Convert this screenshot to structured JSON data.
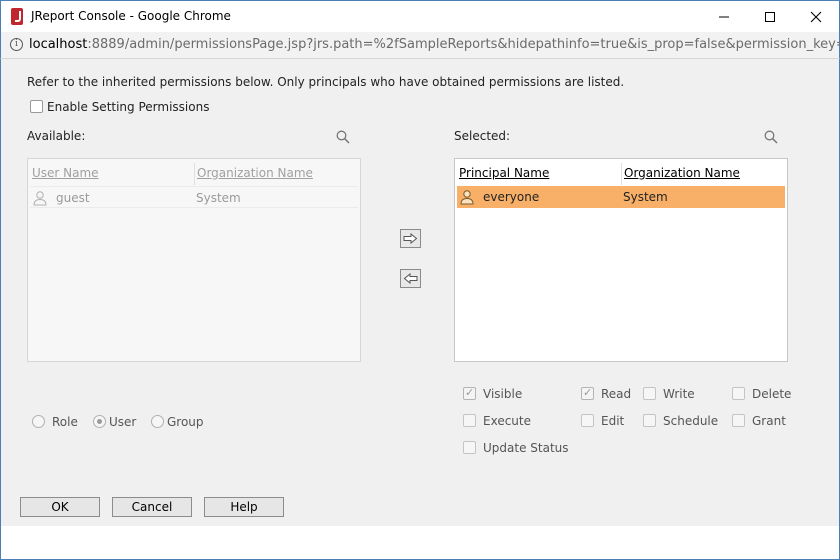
{
  "window": {
    "title": "JReport Console - Google Chrome",
    "url_host": "localhost",
    "url_rest": ":8889/admin/permissionsPage.jsp?jrs.path=%2fSampleReports&hidepathinfo=true&is_prop=false&permission_key="
  },
  "intro_text": "Refer to the inherited permissions below. Only principals who have obtained permissions are listed.",
  "enable_setting": {
    "label": "Enable Setting Permissions",
    "checked": false
  },
  "available": {
    "label": "Available:",
    "columns": [
      "User Name",
      "Organization Name"
    ],
    "rows": [
      {
        "name": "guest",
        "org": "System"
      }
    ]
  },
  "selected": {
    "label": "Selected:",
    "columns": [
      "Principal Name",
      "Organization Name"
    ],
    "rows": [
      {
        "name": "everyone",
        "org": "System",
        "selected": true
      }
    ]
  },
  "principal_type": {
    "options": [
      "Role",
      "User",
      "Group"
    ],
    "selected": "User"
  },
  "permissions": [
    {
      "label": "Visible",
      "checked": true
    },
    {
      "label": "Read",
      "checked": true
    },
    {
      "label": "Write",
      "checked": false
    },
    {
      "label": "Delete",
      "checked": false
    },
    {
      "label": "Execute",
      "checked": false
    },
    {
      "label": "Edit",
      "checked": false
    },
    {
      "label": "Schedule",
      "checked": false
    },
    {
      "label": "Grant",
      "checked": false
    },
    {
      "label": "Update Status",
      "checked": false
    }
  ],
  "buttons": {
    "ok": "OK",
    "cancel": "Cancel",
    "help": "Help"
  },
  "colors": {
    "selected_row": "#f8b068",
    "window_border": "#4a7fb8",
    "content_bg": "#f0f0f0"
  }
}
